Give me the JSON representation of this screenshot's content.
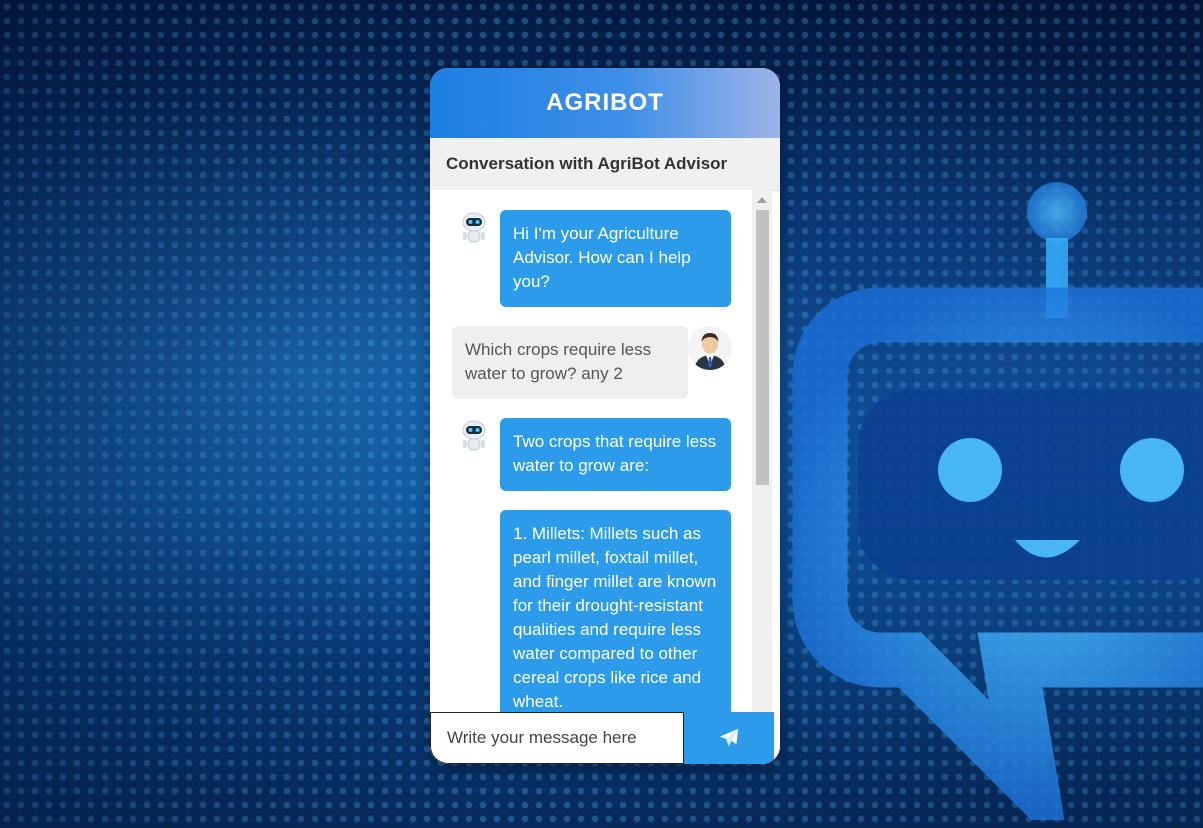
{
  "app": {
    "title": "AGRIBOT",
    "subtitle": "Conversation with AgriBot Advisor"
  },
  "messages": [
    {
      "sender": "bot",
      "avatar": "robot-avatar-icon",
      "text": "Hi I'm your Agriculture Advisor. How can I help you?"
    },
    {
      "sender": "user",
      "avatar": "user-avatar-icon",
      "text": "Which crops require less water to grow? any 2"
    },
    {
      "sender": "bot",
      "avatar": "robot-avatar-icon",
      "text": "Two crops that require less water to grow are:"
    },
    {
      "sender": "bot",
      "text": "1. Millets: Millets such as pearl millet, foxtail millet, and finger millet are known for their drought-resistant qualities and require less water compared to other cereal crops like rice and wheat."
    }
  ],
  "input": {
    "placeholder": "Write your message here",
    "value": ""
  },
  "send_button": {
    "icon": "paper-plane-icon"
  },
  "colors": {
    "accent": "#2b9bea",
    "header_start": "#1d7fe4",
    "header_end": "#9db3e8",
    "user_bubble": "#efefef"
  }
}
